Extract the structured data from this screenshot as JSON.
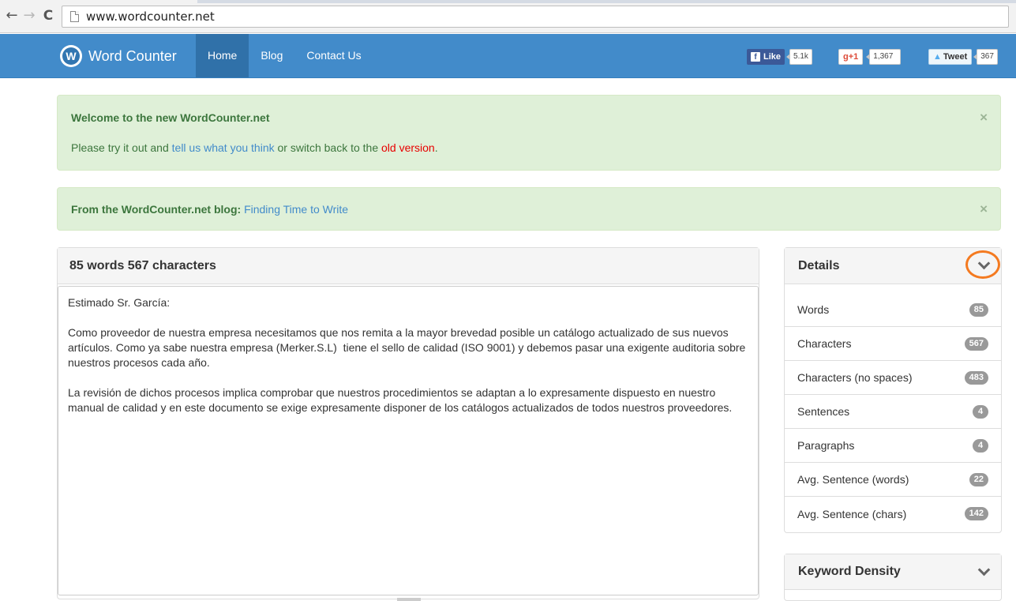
{
  "browser": {
    "url": "www.wordcounter.net",
    "back_glyph": "←",
    "forward_glyph": "→",
    "reload_glyph": "C"
  },
  "navbar": {
    "logo_letter": "W",
    "brand": "Word Counter",
    "links": [
      "Home",
      "Blog",
      "Contact Us"
    ],
    "facebook": {
      "label": "Like",
      "count": "5.1k"
    },
    "google": {
      "label": "+1",
      "count": "1,367"
    },
    "twitter": {
      "label": "Tweet",
      "count": "367"
    }
  },
  "alerts": {
    "welcome": {
      "heading": "Welcome to the new WordCounter.net",
      "prefix": "Please try it out and ",
      "link1": "tell us what you think",
      "middle": " or switch back to the ",
      "link2": "old version",
      "suffix": "."
    },
    "blog": {
      "heading": "From the WordCounter.net blog:",
      "link": "Finding Time to Write"
    },
    "close_glyph": "×"
  },
  "main": {
    "title": "85 words 567 characters",
    "text": "Estimado Sr. García:\n\nComo proveedor de nuestra empresa necesitamos que nos remita a la mayor brevedad posible un catálogo actualizado de sus nuevos artículos. Como ya sabe nuestra empresa (Merker.S.L)  tiene el sello de calidad (ISO 9001) y debemos pasar una exigente auditoria sobre nuestros procesos cada año.\n\nLa revisión de dichos procesos implica comprobar que nuestros procedimientos se adaptan a lo expresamente dispuesto en nuestro manual de calidad y en este documento se exige expresamente disponer de los catálogos actualizados de todos nuestros proveedores."
  },
  "details": {
    "title": "Details",
    "stats": [
      {
        "label": "Words",
        "value": "85"
      },
      {
        "label": "Characters",
        "value": "567"
      },
      {
        "label": "Characters (no spaces)",
        "value": "483"
      },
      {
        "label": "Sentences",
        "value": "4"
      },
      {
        "label": "Paragraphs",
        "value": "4"
      },
      {
        "label": "Avg. Sentence (words)",
        "value": "22"
      },
      {
        "label": "Avg. Sentence (chars)",
        "value": "142"
      }
    ]
  },
  "keyword_density": {
    "title": "Keyword Density"
  },
  "colors": {
    "navbar": "#428bca",
    "alert_bg": "#dff0d8",
    "highlight": "#f47a20"
  }
}
